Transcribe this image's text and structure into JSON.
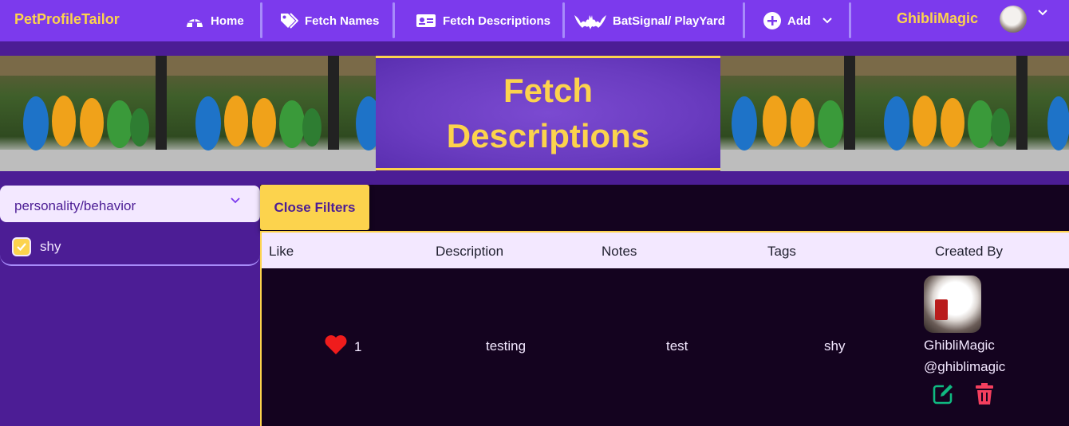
{
  "navbar": {
    "brand": "PetProfileTailor",
    "items": [
      {
        "label": "Home",
        "icon": "igloo-icon"
      },
      {
        "label": "Fetch Names",
        "icon": "tags-icon"
      },
      {
        "label": "Fetch Descriptions",
        "icon": "id-card-icon"
      },
      {
        "label": "BatSignal/ PlayYard",
        "icon": "bat-icon"
      },
      {
        "label": "Add",
        "icon": "plus-circle-icon"
      }
    ],
    "user_name": "GhibliMagic"
  },
  "banner": {
    "title_line1": "Fetch",
    "title_line2": "Descriptions"
  },
  "filters": {
    "category": "personality/behavior",
    "tags": [
      {
        "label": "shy",
        "checked": true
      }
    ],
    "close_label": "Close Filters"
  },
  "table": {
    "headers": [
      "Like",
      "Description",
      "Notes",
      "Tags",
      "Created By"
    ],
    "rows": [
      {
        "likes": "1",
        "description": "testing",
        "notes": "test",
        "tags": "shy",
        "creator_name": "GhibliMagic",
        "creator_handle": "@ghiblimagic"
      }
    ]
  },
  "colors": {
    "nav_bg": "#7c3aed",
    "accent_yellow": "#fcd34d",
    "deep_purple": "#4c1d95",
    "table_bg": "#14031f",
    "header_bg": "#f3e8ff",
    "heart_red": "#ef1c1c",
    "edit_green": "#10b981",
    "delete_red": "#f43f5e"
  }
}
